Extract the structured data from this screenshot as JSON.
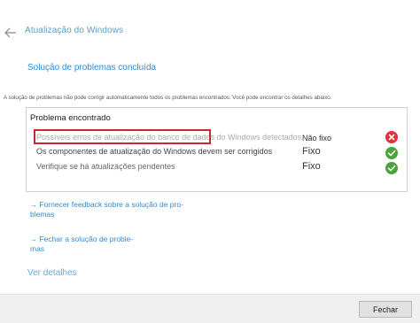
{
  "window": {
    "title": "Atualização do Windows"
  },
  "page_title": "Solução de problemas concluída",
  "summary": "A solução de problemas não pode corrigir automaticamente todos os problemas encontrados. Você pode encontrar os detalhes abaixo.",
  "panel": {
    "heading": "Problema encontrado",
    "rows": [
      {
        "label": "Possíveis erros de atualização do banco de dados do Windows detectados",
        "status": "Não fixo",
        "icon": "error-icon"
      },
      {
        "label": "Os componentes de atualização do Windows devem ser corrigidos",
        "status": "Fixo",
        "icon": "check-icon"
      },
      {
        "label": "Verifique se há atualizações pendentes",
        "status": "Fixo",
        "icon": "check-icon"
      }
    ]
  },
  "links": {
    "feedback_line1": "Fornecer feedback sobre a solução de pro-",
    "feedback_line2": "blemas",
    "close_line1": "Fechar a solução de proble-",
    "close_line2": "mas",
    "arrow": "→"
  },
  "more_details": "Ver detalhes",
  "footer": {
    "close_label": "Fechar"
  },
  "colors": {
    "accent": "#2d8bd4",
    "error": "#e0343a",
    "success": "#4aa43a",
    "highlight": "#c42a30"
  }
}
